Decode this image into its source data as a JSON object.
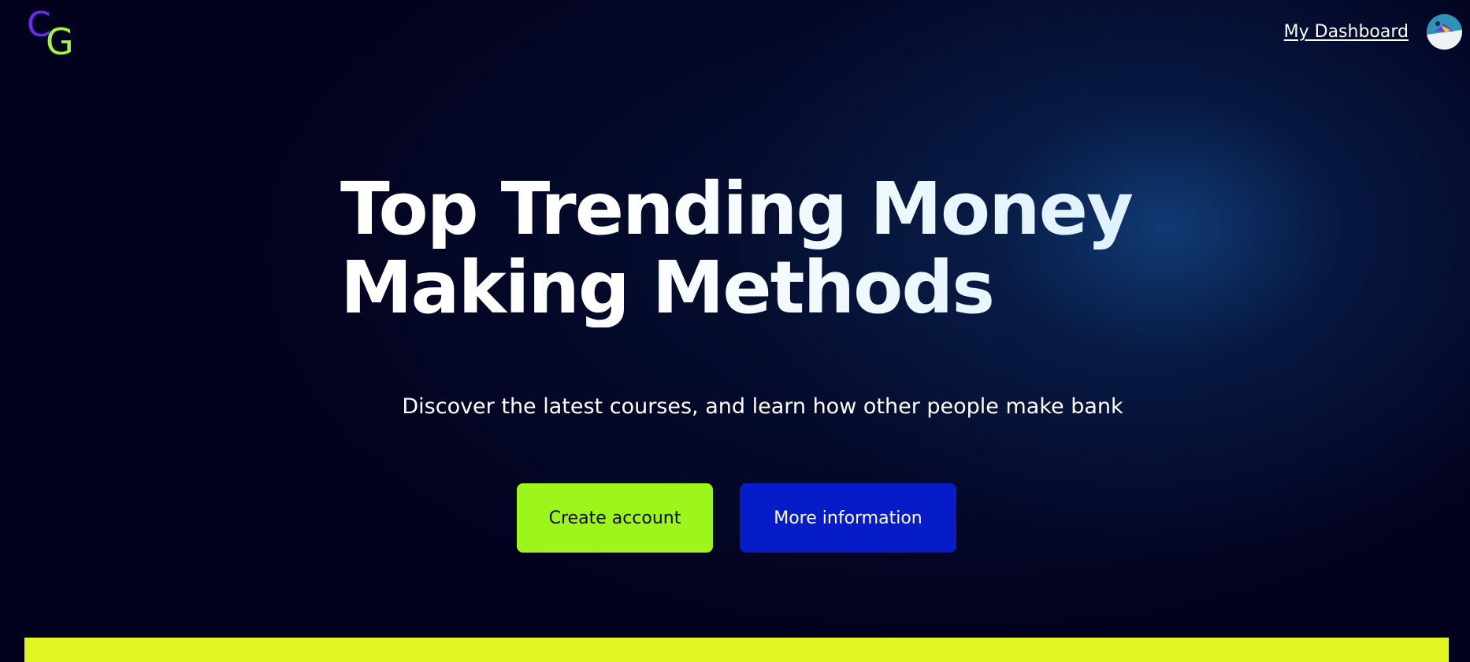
{
  "header": {
    "logo": {
      "letter_1": "C",
      "letter_2": "G",
      "color_1": "#6d28f0",
      "color_2": "#a3f53a"
    },
    "nav_link": "My Dashboard",
    "avatar_icon": "user-avatar-icon"
  },
  "hero": {
    "title_line_1": "Top Trending Money",
    "title_line_2": "Making Methods",
    "subtitle": "Discover the latest courses, and learn how other people make bank",
    "primary_button": "Create account",
    "secondary_button": "More information"
  },
  "colors": {
    "background": "#02021f",
    "primary_button": "#9df51c",
    "secondary_button": "#061cc8",
    "band": "#e0f522"
  }
}
